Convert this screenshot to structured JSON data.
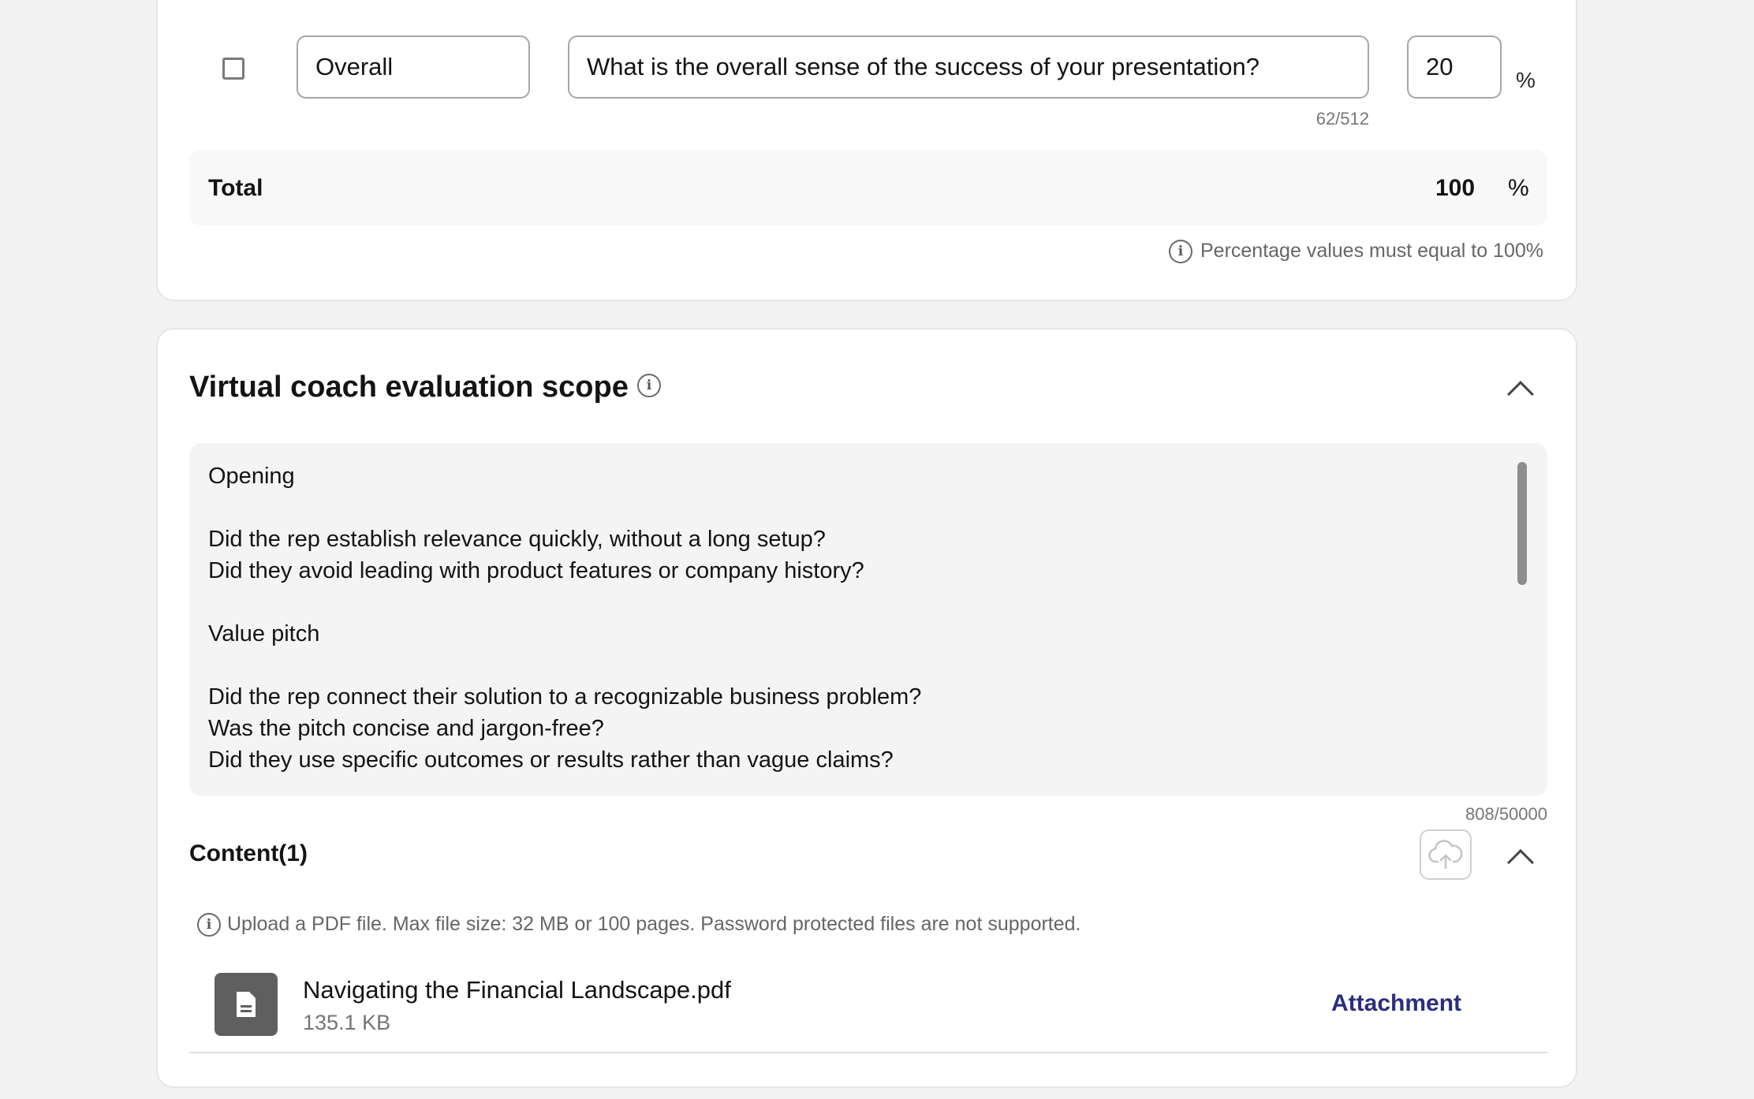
{
  "criteria_row": {
    "name": "Overall",
    "question": "What is the overall sense of the success of your presentation?",
    "question_count": "62/512",
    "weight": "20",
    "weight_unit": "%"
  },
  "total": {
    "label": "Total",
    "value": "100",
    "unit": "%"
  },
  "percentage_note": "Percentage values must equal to 100%",
  "scope": {
    "title": "Virtual coach evaluation scope",
    "text": "Opening\n\nDid the rep establish relevance quickly, without a long setup?\nDid they avoid leading with product features or company history?\n\nValue pitch\n\nDid the rep connect their solution to a recognizable business problem?\nWas the pitch concise and jargon-free?\nDid they use specific outcomes or results rather than vague claims?",
    "char_count": "808/50000"
  },
  "content": {
    "heading": "Content(1)",
    "upload_note": "Upload a PDF file. Max file size: 32 MB or 100 pages. Password protected files are not supported.",
    "files": [
      {
        "name": "Navigating the Financial Landscape.pdf",
        "size": "135.1 KB",
        "type_label": "Attachment",
        "icon": "document-icon"
      }
    ],
    "upload_icon": "cloud-upload-icon"
  },
  "colors": {
    "accent_link": "#2b2e7d",
    "page_background": "#f2f2f2"
  }
}
